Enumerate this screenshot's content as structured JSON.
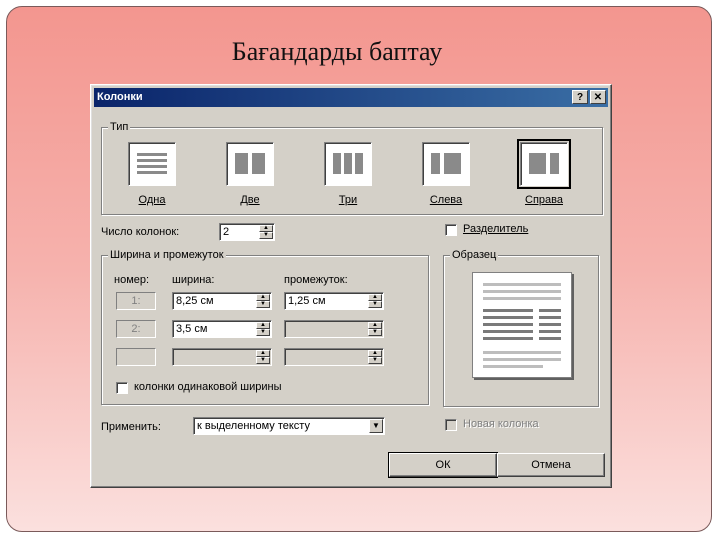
{
  "slide": {
    "title": "Бағандарды баптау"
  },
  "dialog": {
    "title": "Колонки",
    "help_glyph": "?",
    "close_glyph": "✕",
    "type_group": "Тип",
    "presets": [
      "Одна",
      "Две",
      "Три",
      "Слева",
      "Справа"
    ],
    "selected_preset": "Справа",
    "num_columns_label": "Число колонок:",
    "num_columns_value": "2",
    "separator_label": "Разделитель",
    "width_group": "Ширина и промежуток",
    "col_header_num": "номер:",
    "col_header_width": "ширина:",
    "col_header_gap": "промежуток:",
    "rows": [
      {
        "num": "1:",
        "width": "8,25 см",
        "gap": "1,25 см"
      },
      {
        "num": "2:",
        "width": "3,5 см",
        "gap": ""
      },
      {
        "num": "",
        "width": "",
        "gap": ""
      }
    ],
    "equal_width_label": "колонки одинаковой ширины",
    "preview_group": "Образец",
    "apply_label": "Применить:",
    "apply_value": "к выделенному тексту",
    "new_column_label": "Новая колонка",
    "ok_label": "ОК",
    "cancel_label": "Отмена"
  }
}
